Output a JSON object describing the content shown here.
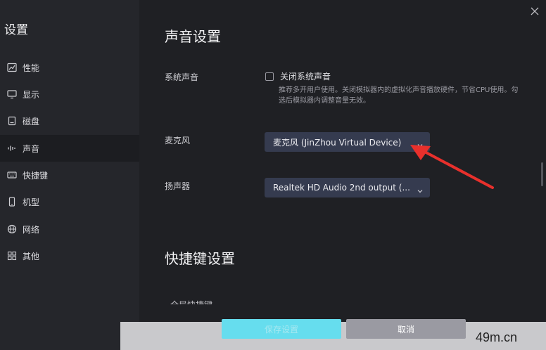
{
  "sidebar": {
    "title": "设置",
    "items": [
      {
        "label": "性能",
        "icon": "chart-icon"
      },
      {
        "label": "显示",
        "icon": "monitor-icon"
      },
      {
        "label": "磁盘",
        "icon": "disk-icon"
      },
      {
        "label": "声音",
        "icon": "sound-wave-icon",
        "active": true
      },
      {
        "label": "快捷键",
        "icon": "keyboard-icon"
      },
      {
        "label": "机型",
        "icon": "phone-icon"
      },
      {
        "label": "网络",
        "icon": "globe-icon"
      },
      {
        "label": "其他",
        "icon": "grid-icon"
      }
    ]
  },
  "sound": {
    "section_title": "声音设置",
    "system_sound_label": "系统声音",
    "mute_checkbox_label": "关闭系统声音",
    "mute_checked": false,
    "mute_hint": "推荐多开用户使用。关闭模拟器内的虚拟化声音播放硬件，节省CPU使用。勾选后模拟器内调整音量无效。",
    "microphone_label": "麦克风",
    "microphone_value": "麦克风 (JinZhou Virtual Device)",
    "speaker_label": "扬声器",
    "speaker_value": "Realtek HD Audio 2nd output (..."
  },
  "shortcuts": {
    "section_title": "快捷键设置",
    "partial_item": "全局快捷键"
  },
  "footer": {
    "save_label": "保存设置",
    "cancel_label": "取消"
  },
  "watermark": "49m.cn",
  "colors": {
    "background": "#1f2024",
    "sidebar": "#25262b",
    "select_bg": "#353b4f",
    "save_button": "#66ddee",
    "annotation_arrow": "#e8302c"
  }
}
